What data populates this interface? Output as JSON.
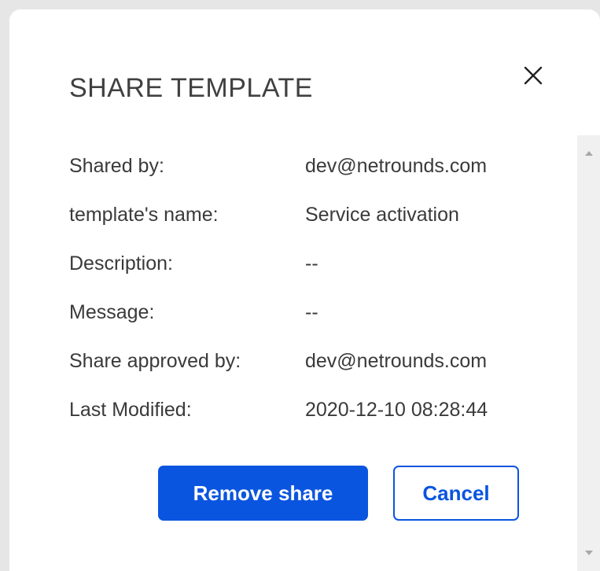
{
  "dialog": {
    "title": "SHARE TEMPLATE",
    "close_icon": "close-icon"
  },
  "details": [
    {
      "label": "Shared by:",
      "value": "dev@netrounds.com"
    },
    {
      "label": "template's name:",
      "value": "Service activation"
    },
    {
      "label": "Description:",
      "value": "--"
    },
    {
      "label": "Message:",
      "value": "--"
    },
    {
      "label": "Share approved by:",
      "value": "dev@netrounds.com"
    },
    {
      "label": "Last Modified:",
      "value": "2020-12-10 08:28:44"
    }
  ],
  "actions": {
    "remove_label": "Remove share",
    "cancel_label": "Cancel"
  },
  "colors": {
    "primary": "#0a55e0",
    "text": "#3a3a3a",
    "title": "#404040"
  }
}
